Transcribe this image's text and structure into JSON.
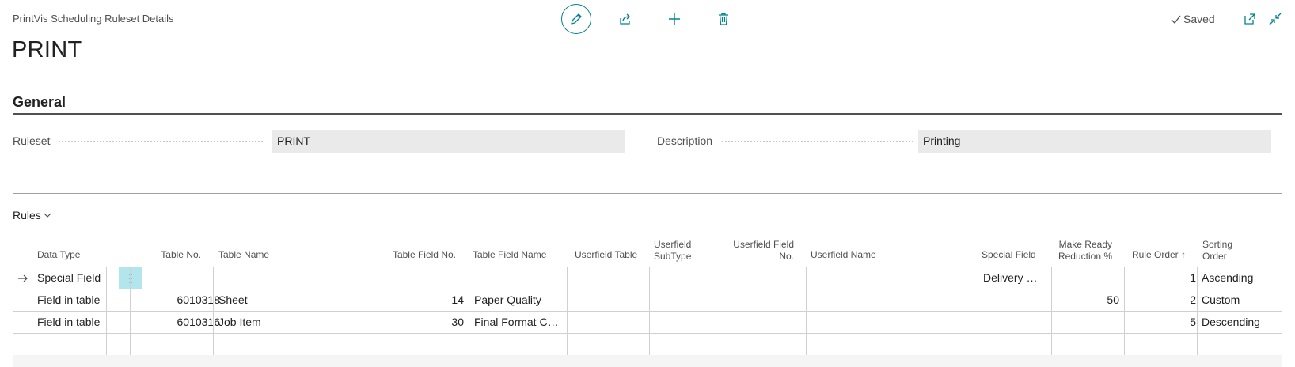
{
  "header": {
    "caption": "PrintVis Scheduling Ruleset Details",
    "title": "PRINT",
    "status": "Saved"
  },
  "toolbar": {
    "icons": [
      "edit-icon",
      "share-icon",
      "new-icon",
      "delete-icon"
    ]
  },
  "general": {
    "section_title": "General",
    "ruleset_label": "Ruleset",
    "ruleset_value": "PRINT",
    "description_label": "Description",
    "description_value": "Printing"
  },
  "rules": {
    "tab_label": "Rules",
    "columns": {
      "data_type": "Data Type",
      "table_no": "Table No.",
      "table_name": "Table Name",
      "table_field_no": "Table Field No.",
      "table_field_name": "Table Field Name",
      "userfield_table": "Userfield Table",
      "userfield_subtype_1": "Userfield",
      "userfield_subtype_2": "SubType",
      "userfield_field_no_1": "Userfield Field",
      "userfield_field_no_2": "No.",
      "userfield_name": "Userfield Name",
      "special_field": "Special Field",
      "make_ready_1": "Make Ready",
      "make_ready_2": "Reduction %",
      "rule_order": "Rule Order",
      "rule_order_sort": "↑",
      "sorting_order_1": "Sorting",
      "sorting_order_2": "Order"
    },
    "rows": [
      {
        "data_type": "Special Field",
        "table_no": "",
        "table_name": "",
        "table_field_no": "",
        "table_field_name": "",
        "special_field": "Delivery We...",
        "make_ready": "",
        "rule_order": "1",
        "sorting_order": "Ascending"
      },
      {
        "data_type": "Field in table",
        "table_no": "6010318",
        "table_name": "Sheet",
        "table_field_no": "14",
        "table_field_name": "Paper Quality",
        "special_field": "",
        "make_ready": "50",
        "rule_order": "2",
        "sorting_order": "Custom"
      },
      {
        "data_type": "Field in table",
        "table_no": "6010316",
        "table_name": "Job Item",
        "table_field_no": "30",
        "table_field_name": "Final Format Code",
        "special_field": "",
        "make_ready": "",
        "rule_order": "5",
        "sorting_order": "Descending"
      }
    ]
  },
  "colors": {
    "accent": "#00838f",
    "selected_cell": "#b3e5ec",
    "field_bg": "#eaeaea"
  }
}
